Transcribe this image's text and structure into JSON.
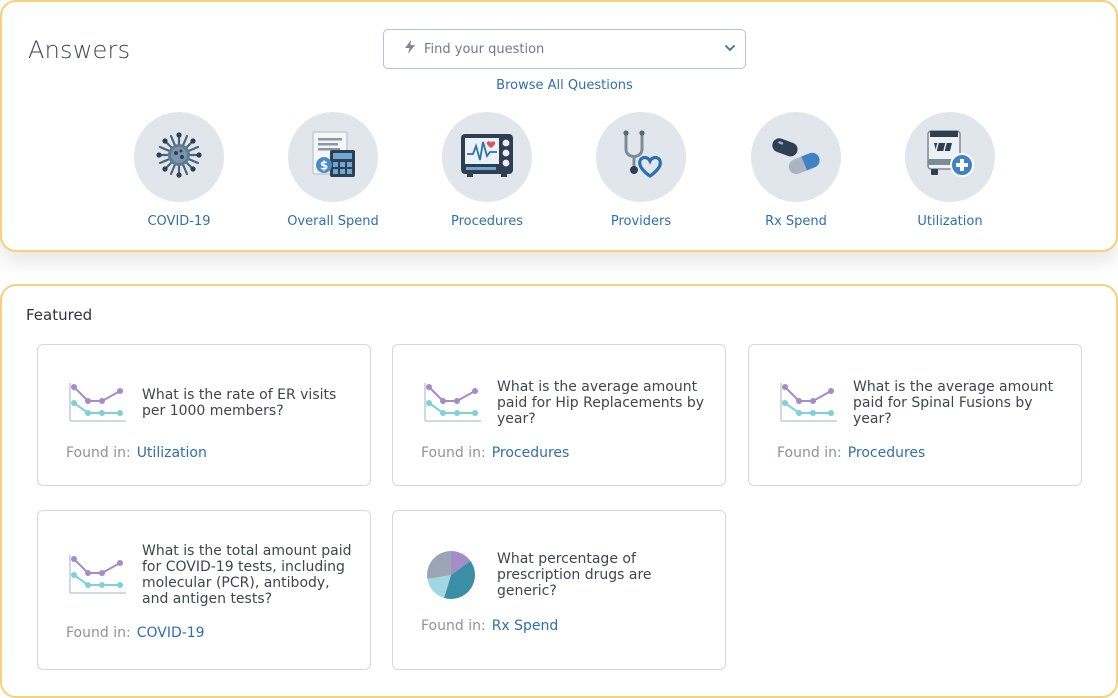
{
  "answers": {
    "title": "Answers",
    "search": {
      "icon": "lightning-icon",
      "placeholder": "Find your question",
      "dropdown_icon": "chevron-down-icon"
    },
    "browse_link": "Browse All Questions",
    "categories": [
      {
        "label": "COVID-19",
        "icon": "virus-icon"
      },
      {
        "label": "Overall Spend",
        "icon": "invoice-calculator-icon"
      },
      {
        "label": "Procedures",
        "icon": "heart-monitor-icon"
      },
      {
        "label": "Providers",
        "icon": "stethoscope-icon"
      },
      {
        "label": "Rx Spend",
        "icon": "pills-icon"
      },
      {
        "label": "Utilization",
        "icon": "ambulance-icon"
      }
    ]
  },
  "featured": {
    "title": "Featured",
    "found_in_label": "Found in:",
    "cards": [
      {
        "question": "What is the rate of ER visits per 1000 members?",
        "found_in": "Utilization",
        "icon": "line-chart-icon"
      },
      {
        "question": "What is the average amount paid for Hip Replacements by year?",
        "found_in": "Procedures",
        "icon": "line-chart-icon"
      },
      {
        "question": "What is the average amount paid for Spinal Fusions by year?",
        "found_in": "Procedures",
        "icon": "line-chart-icon"
      },
      {
        "question": "What is the total amount paid for COVID-19 tests, including molecular (PCR), antibody, and antigen tests?",
        "found_in": "COVID-19",
        "icon": "line-chart-icon"
      },
      {
        "question": "What percentage of prescription drugs are generic?",
        "found_in": "Rx Spend",
        "icon": "pie-chart-icon"
      }
    ]
  },
  "colors": {
    "panel_border": "#f5d27a",
    "link": "#2f6fae",
    "icon_circle": "#e1e6ec"
  }
}
